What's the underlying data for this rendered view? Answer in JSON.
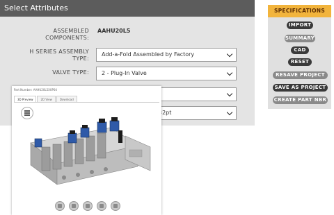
{
  "attributes": {
    "title": "Select Attributes",
    "assembled_components_label": "ASSEMBLED COMPONENTS:",
    "assembled_components_value": "AAHU20L5",
    "h_series_label": "H SERIES ASSEMBLY TYPE:",
    "h_series_value": "Add-a-Fold Assembled by Factory",
    "valve_type_label": "VALVE TYPE:",
    "valve_type_value": "2 - Plug-In Valve",
    "row4_value": "",
    "row5_value": "32pt"
  },
  "specifications": {
    "header": "SPECIFICATIONS",
    "buttons": [
      "IMPORT",
      "SUMMARY",
      "CAD",
      "RESET",
      "RESAVE PROJECT",
      "SAVE AS PROJECT",
      "CREATE PART NBR"
    ]
  },
  "viewer": {
    "part_number": "Part Number: AAHU20L5X0P04",
    "tabs": [
      "3D Preview",
      "2D View",
      "Download"
    ],
    "toolbar_icons": [
      "cube-view-icon",
      "wireframe-icon",
      "iso-view-icon",
      "layers-icon",
      "shaded-view-icon"
    ]
  },
  "colors": {
    "header_bg": "#5c5c5c",
    "panel_bg": "#e4e4e4",
    "spec_header": "#f2b43c",
    "button_dark": "#3a3a3a",
    "valve_blue": "#2f5aa8",
    "part_gray": "#b8b8b8"
  }
}
